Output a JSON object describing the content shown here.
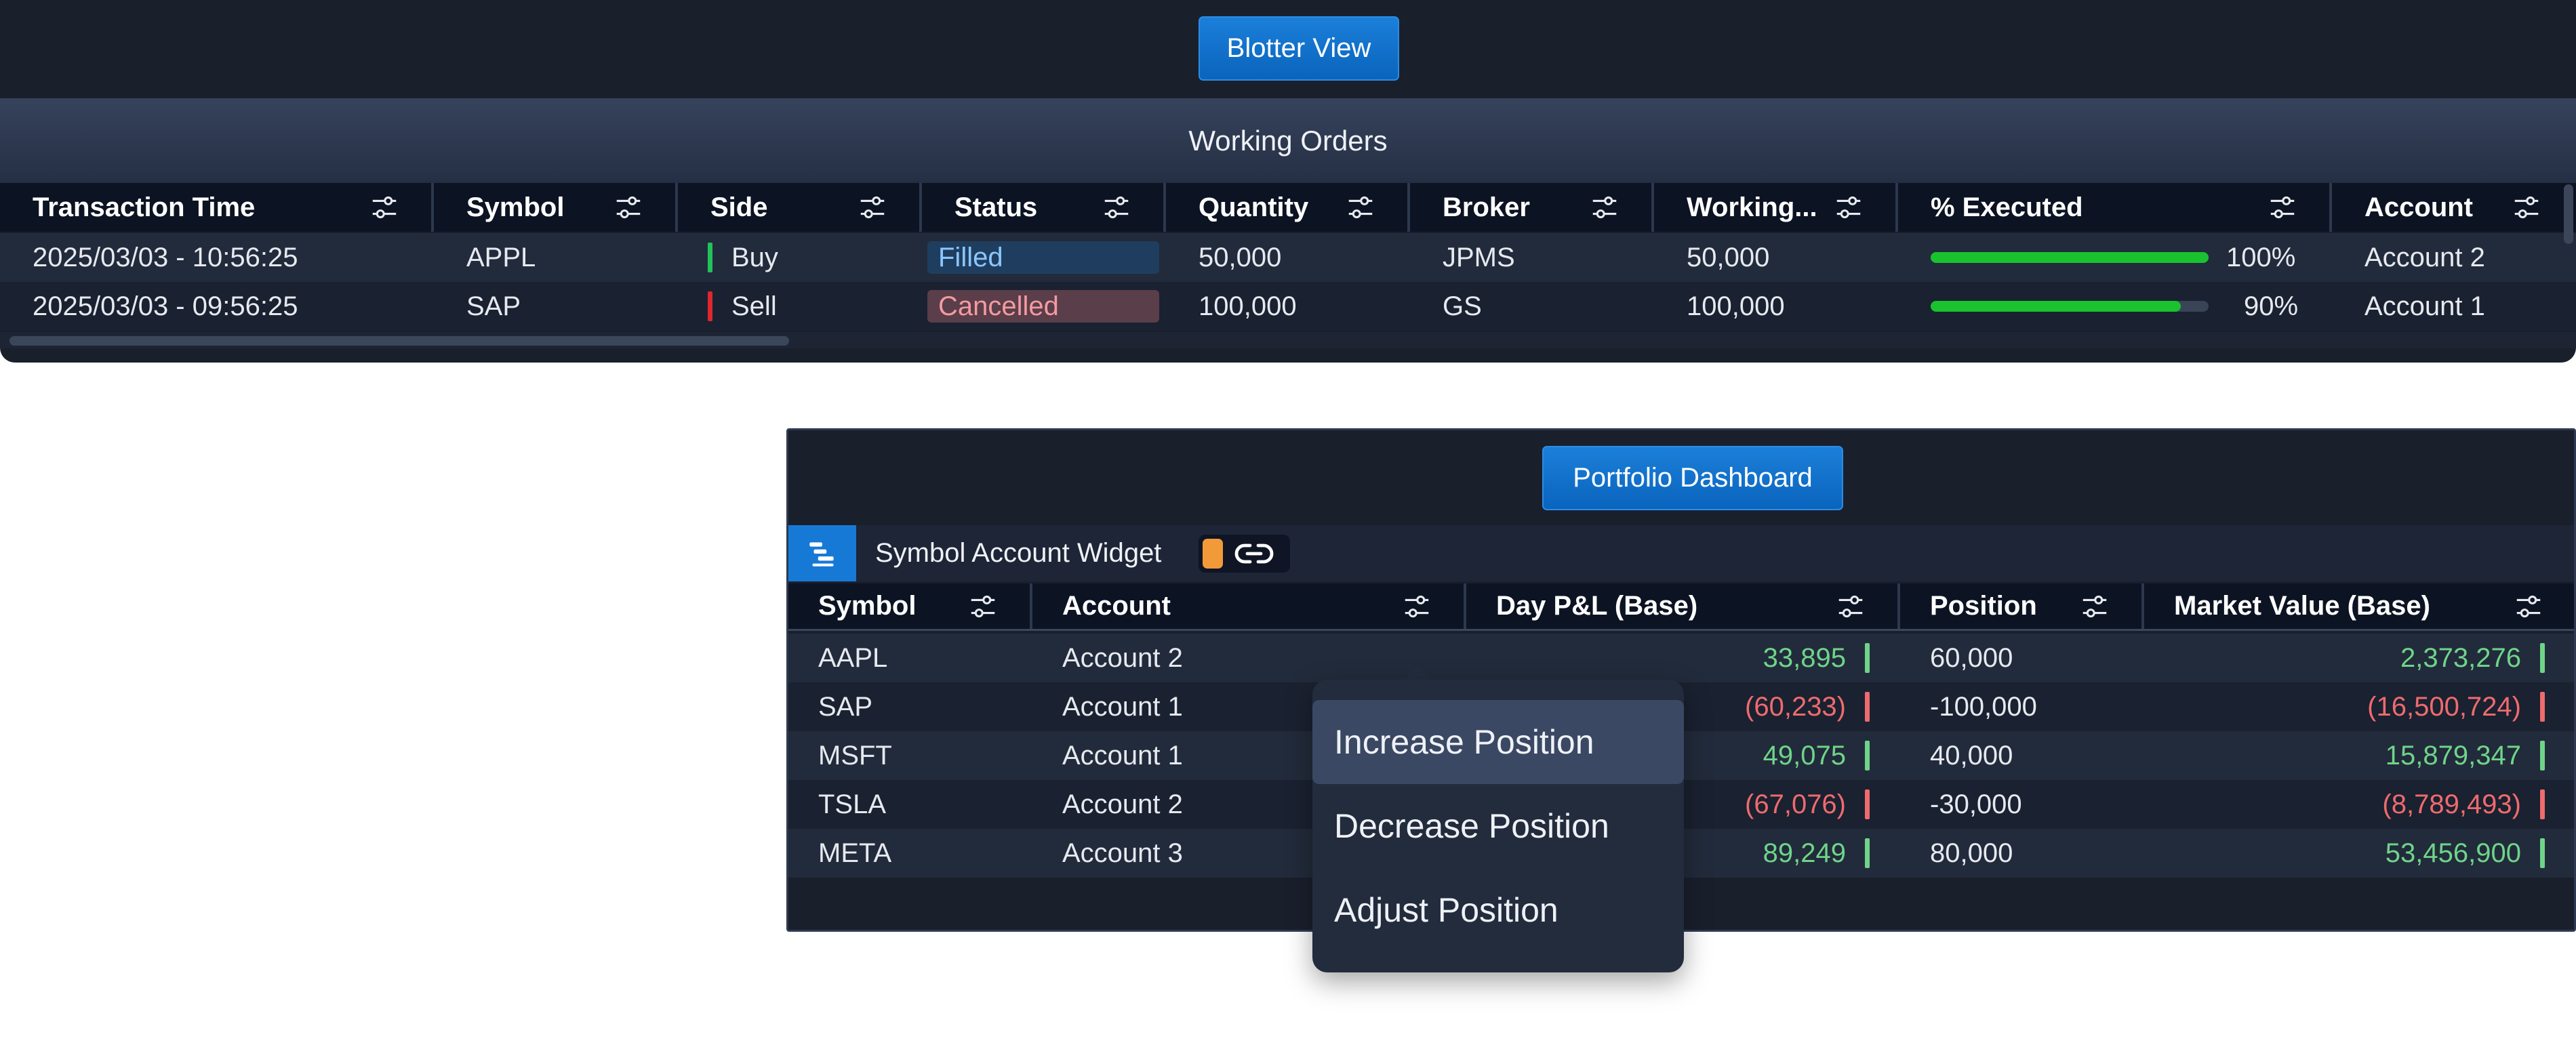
{
  "blotter": {
    "button_label": "Blotter View",
    "title": "Working Orders",
    "columns": [
      "Transaction Time",
      "Symbol",
      "Side",
      "Status",
      "Quantity",
      "Broker",
      "Working...",
      "% Executed",
      "Account"
    ],
    "rows": [
      {
        "time": "2025/03/03 - 10:56:25",
        "symbol": "APPL",
        "side": "Buy",
        "status": "Filled",
        "quantity": "50,000",
        "broker": "JPMS",
        "working": "50,000",
        "executed": 1.0,
        "executed_label": "100%",
        "account": "Account 2"
      },
      {
        "time": "2025/03/03 - 09:56:25",
        "symbol": "SAP",
        "side": "Sell",
        "status": "Cancelled",
        "quantity": "100,000",
        "broker": "GS",
        "working": "100,000",
        "executed": 0.9,
        "executed_label": "90%",
        "account": "Account 1"
      }
    ]
  },
  "portfolio": {
    "button_label": "Portfolio Dashboard",
    "widget_title": "Symbol Account Widget",
    "columns": [
      "Symbol",
      "Account",
      "Day P&L (Base)",
      "Position",
      "Market Value (Base)"
    ],
    "rows": [
      {
        "symbol": "AAPL",
        "account": "Account 2",
        "pnl": "33,895",
        "position": "60,000",
        "market_value": "2,373,276"
      },
      {
        "symbol": "SAP",
        "account": "Account 1",
        "pnl": "(60,233)",
        "position": "-100,000",
        "market_value": "(16,500,724)"
      },
      {
        "symbol": "MSFT",
        "account": "Account 1",
        "pnl": "49,075",
        "position": "40,000",
        "market_value": "15,879,347"
      },
      {
        "symbol": "TSLA",
        "account": "Account 2",
        "pnl": "(67,076)",
        "position": "-30,000",
        "market_value": "(8,789,493)"
      },
      {
        "symbol": "META",
        "account": "Account 3",
        "pnl": "89,249",
        "position": "80,000",
        "market_value": "53,456,900"
      }
    ]
  },
  "context_menu": {
    "items": [
      "Increase Position",
      "Decrease Position",
      "Adjust Position"
    ],
    "active_index": 0
  },
  "colors": {
    "buy": "#21c25a",
    "sell": "#e0262e",
    "filled_bg": "#1f3e5f",
    "filled_text": "#8cc6ff",
    "cancelled_bg": "#5a3e4a",
    "cancelled_text": "#f49aa0",
    "positive": "#6fd48a",
    "negative": "#ee6b6e",
    "accent": "#1779d6"
  }
}
